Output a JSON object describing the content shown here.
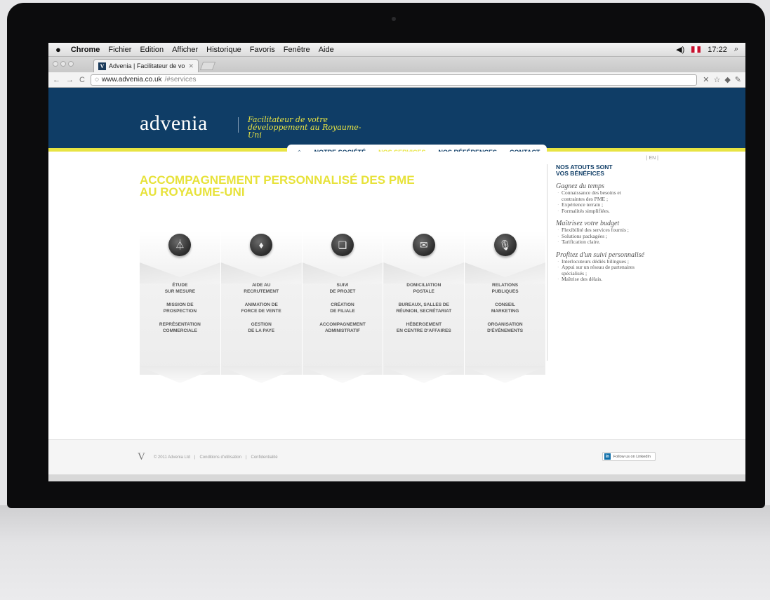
{
  "menubar": {
    "app": "Chrome",
    "items": [
      "Fichier",
      "Edition",
      "Afficher",
      "Historique",
      "Favoris",
      "Fenêtre",
      "Aide"
    ],
    "clock": "17:22",
    "search_icon": "search-icon",
    "volume_icon": "volume-icon"
  },
  "browser": {
    "tab_title": "Advenia | Facilitateur de vo",
    "favicon_letter": "V",
    "url_host": "www.advenia.co.uk",
    "url_path": "/#services",
    "back_glyph": "←",
    "forward_glyph": "→",
    "reload_glyph": "C"
  },
  "site": {
    "logo": "advenia",
    "tagline": "Facilitateur de votre développement au Royaume-Uni",
    "nav": {
      "home_glyph": "⌂",
      "items": [
        "NOTRE SOCIÉTÉ",
        "NOS SERVICES",
        "NOS RÉFÉRENCES",
        "CONTACT"
      ],
      "active_index": 1
    },
    "lang": "| EN |",
    "headline_line1": "ACCOMPAGNEMENT PERSONNALISÉ DES PME",
    "headline_line2": "AU ROYAUME-UNI",
    "colors": {
      "navy": "#0f3d66",
      "yellow": "#e8e443"
    }
  },
  "services": [
    {
      "icon": "surveyor-tripod-icon",
      "glyph": "⏃",
      "lines": [
        [
          "ÉTUDE",
          "SUR MESURE"
        ],
        [
          "MISSION DE",
          "PROSPECTION"
        ],
        [
          "REPRÉSENTATION",
          "COMMERCIALE"
        ]
      ]
    },
    {
      "icon": "suit-tie-icon",
      "glyph": "♦",
      "lines": [
        [
          "AIDE AU",
          "RECRUTEMENT"
        ],
        [
          "ANIMATION DE",
          "FORCE DE VENTE"
        ],
        [
          "GESTION",
          "DE LA PAYE"
        ]
      ]
    },
    {
      "icon": "document-seal-icon",
      "glyph": "❏",
      "lines": [
        [
          "SUIVI",
          "DE PROJET"
        ],
        [
          "CRÉATION",
          "DE FILIALE"
        ],
        [
          "ACCOMPAGNEMENT",
          "ADMINISTRATIF"
        ]
      ]
    },
    {
      "icon": "envelope-icon",
      "glyph": "✉",
      "lines": [
        [
          "DOMICILIATION",
          "POSTALE"
        ],
        [
          "BUREAUX, SALLES DE",
          "RÉUNION, SECRÉTARIAT"
        ],
        [
          "HÉBERGEMENT",
          "EN CENTRE D'AFFAIRES"
        ]
      ]
    },
    {
      "icon": "microphone-icon",
      "glyph": "🎙",
      "lines": [
        [
          "RELATIONS",
          "PUBLIQUES"
        ],
        [
          "CONSEIL",
          "MARKETING"
        ],
        [
          "ORGANISATION",
          "D'ÉVÉNEMENTS"
        ]
      ]
    }
  ],
  "sidebar": {
    "title_line1": "NOS ATOUTS SONT",
    "title_line2": "VOS BÉNÉFICES",
    "groups": [
      {
        "title": "Gagnez du temps",
        "items": [
          "Connaissance des besoins et contraintes des PME ;",
          "Expérience terrain ;",
          "Formalités simplifiées."
        ]
      },
      {
        "title": "Maîtrisez votre budget",
        "items": [
          "Flexibilité des services fournis ;",
          "Solutions packagées ;",
          "Tarification claire."
        ]
      },
      {
        "title": "Profitez d'un suivi personnalisé",
        "items": [
          "Interlocuteurs dédiés bilingues ;",
          "Appui sur un réseau de partenaires spécialisés ;",
          "Maîtrise des délais."
        ]
      }
    ]
  },
  "footer": {
    "mark": "V",
    "copyright": "© 2011 Advenia Ltd",
    "links": [
      "Conditions d'utilisation",
      "Confidentialité"
    ],
    "linkedin_label": "Follow us on LinkedIn"
  }
}
